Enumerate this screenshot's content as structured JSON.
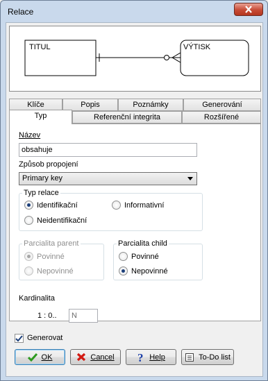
{
  "window": {
    "title": "Relace"
  },
  "diagram": {
    "entity_left": "TITUL",
    "entity_right": "VÝTISK"
  },
  "tabs_row1": [
    "Klíče",
    "Popis",
    "Poznámky",
    "Generování"
  ],
  "tabs_row2": [
    "Typ",
    "Referenční integrita",
    "Rozšířené"
  ],
  "active_tab": "Typ",
  "form": {
    "name_label": "Název",
    "name_value": "obsahuje",
    "join_label": "Způsob propojení",
    "join_value": "Primary key",
    "relation_type": {
      "label": "Typ relace",
      "options": [
        "Identifikační",
        "Informativní",
        "Neidentifikační"
      ],
      "selected": "Identifikační"
    },
    "partiality_parent": {
      "label": "Parcialita parent",
      "options": [
        "Povinné",
        "Nepovinné"
      ],
      "selected": "Povinné",
      "disabled": true
    },
    "partiality_child": {
      "label": "Parcialita child",
      "options": [
        "Povinné",
        "Nepovinné"
      ],
      "selected": "Nepovinné"
    },
    "cardinality_label": "Kardinalita",
    "cardinality_prefix": "1 : 0..",
    "cardinality_value": "N"
  },
  "footer": {
    "generate_label": "Generovat",
    "generate_checked": true,
    "ok_label": "OK",
    "cancel_label": "Cancel",
    "help_label": "Help",
    "todo_label": "To-Do list"
  },
  "colors": {
    "titlebar": "#c9d9ec",
    "close_button": "#c74b35",
    "radio_dot": "#1c3f7a"
  }
}
